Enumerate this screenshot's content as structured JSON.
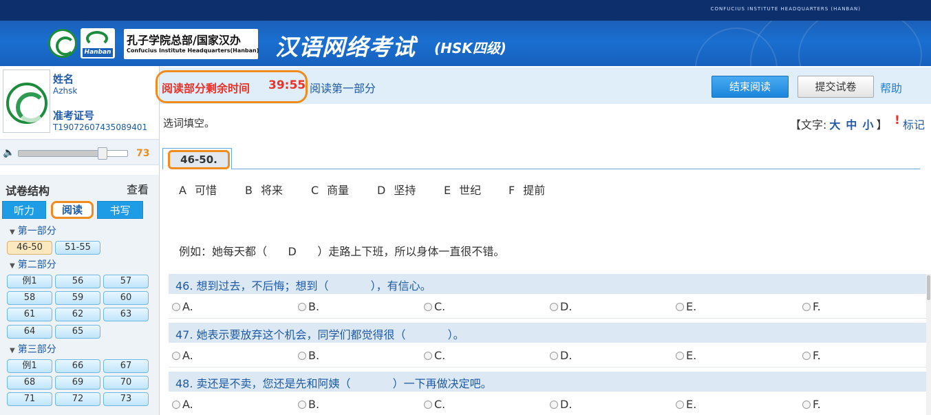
{
  "header": {
    "org_en": "CONFUCIUS INSTITUTE HEADQUARTERS (HANBAN)",
    "logo_hanban": "Hanban",
    "org_cn": "孔子学院总部/国家汉办",
    "org_en_small": "Confucius Institute Headquarters(Hanban)",
    "exam_title": "汉语网络考试",
    "exam_level": "(HSK四级)"
  },
  "candidate": {
    "name_label": "姓名",
    "name_value": "Azhsk",
    "id_label": "准考证号",
    "id_value": "T19072607435089401"
  },
  "volume": {
    "icon": "speaker-icon",
    "value": "73",
    "level_percent": 73
  },
  "structure": {
    "title": "试卷结构",
    "view_label": "查看",
    "tabs": [
      {
        "label": "听力",
        "active": false
      },
      {
        "label": "阅读",
        "active": true
      },
      {
        "label": "书写",
        "active": false
      }
    ],
    "parts": [
      {
        "label": "第一部分",
        "buttons": [
          "46-50",
          "51-55"
        ]
      },
      {
        "label": "第二部分",
        "buttons": [
          "例1",
          "56",
          "57",
          "58",
          "59",
          "60",
          "61",
          "62",
          "63",
          "64",
          "65"
        ]
      },
      {
        "label": "第三部分",
        "buttons": [
          "例1",
          "66",
          "67",
          "68",
          "69",
          "70",
          "71",
          "72",
          "73"
        ]
      }
    ]
  },
  "timer": {
    "label": "阅读部分剩余时间",
    "value": "39:55",
    "part_title": "阅读第一部分"
  },
  "actions": {
    "end_reading": "结束阅读",
    "submit": "提交试卷",
    "help": "帮助"
  },
  "instructions": "选词填空。",
  "font_control": {
    "prefix": "【文字:",
    "large": "大",
    "medium": "中",
    "small": "小",
    "suffix": "】",
    "mark_symbol": "!",
    "mark_label": "标记"
  },
  "question_tab": "46-50.",
  "choices": [
    {
      "letter": "A",
      "word": "可惜"
    },
    {
      "letter": "B",
      "word": "将来"
    },
    {
      "letter": "C",
      "word": "商量"
    },
    {
      "letter": "D",
      "word": "坚持"
    },
    {
      "letter": "E",
      "word": "世纪"
    },
    {
      "letter": "F",
      "word": "提前"
    }
  ],
  "example": "例如：她每天都（      D      ）走路上下班，所以身体一直很不错。",
  "questions": [
    {
      "text": "46. 想到过去，不后悔；想到（            ），有信心。",
      "options": [
        "A.",
        "B.",
        "C.",
        "D.",
        "E.",
        "F."
      ]
    },
    {
      "text": "47. 她表示要放弃这个机会，同学们都觉得很（            ）。",
      "options": [
        "A.",
        "B.",
        "C.",
        "D.",
        "E.",
        "F."
      ]
    },
    {
      "text": "48. 卖还是不卖，您还是先和阿姨（            ）一下再做决定吧。",
      "options": [
        "A.",
        "B.",
        "C.",
        "D.",
        "E.",
        "F."
      ]
    }
  ],
  "colors": {
    "accent_orange": "#f08c1d",
    "timer_red": "#e8332a",
    "primary_blue": "#1f5aa6",
    "button_blue": "#1c86dc"
  }
}
